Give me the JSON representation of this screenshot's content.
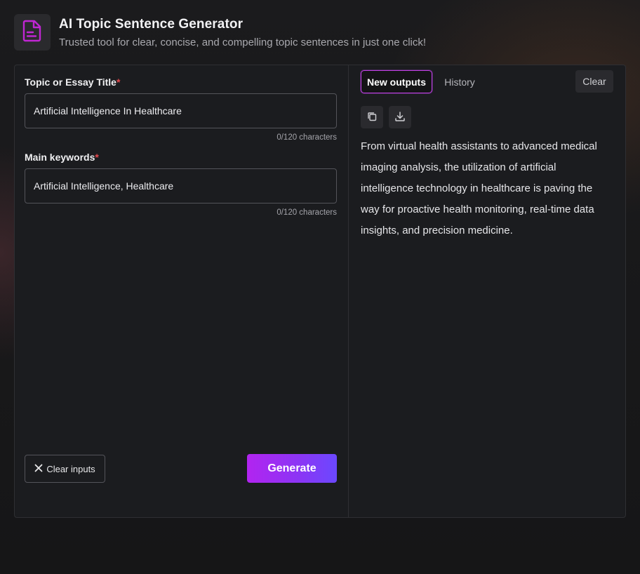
{
  "header": {
    "title": "AI Topic Sentence Generator",
    "subtitle": "Trusted tool for clear, concise, and compelling topic sentences in just one click!",
    "icon": "document-icon",
    "accent_color": "#c026d3"
  },
  "form": {
    "topic": {
      "label": "Topic or Essay Title",
      "required_mark": "*",
      "value": "Artificial Intelligence In Healthcare",
      "char_count": "0/120 characters"
    },
    "keywords": {
      "label": "Main keywords",
      "required_mark": "*",
      "value": "Artificial Intelligence, Healthcare",
      "char_count": "0/120 characters"
    },
    "clear_inputs_label": "Clear inputs",
    "generate_label": "Generate"
  },
  "output": {
    "tabs": [
      {
        "label": "New outputs",
        "active": true
      },
      {
        "label": "History",
        "active": false
      }
    ],
    "clear_label": "Clear",
    "actions": [
      "copy-icon",
      "download-icon"
    ],
    "text": "From virtual health assistants to advanced medical imaging analysis, the utilization of artificial intelligence technology in healthcare is paving the way for proactive health monitoring, real-time data insights, and precision medicine."
  }
}
